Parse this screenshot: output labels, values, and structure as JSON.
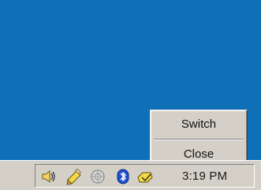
{
  "desktop": {
    "background_color": "#0f6fb7"
  },
  "context_menu": {
    "items": [
      {
        "label": "Switch"
      },
      {
        "label": "Close"
      }
    ]
  },
  "tray": {
    "icons": [
      {
        "name": "speaker-icon"
      },
      {
        "name": "pencil-icon"
      },
      {
        "name": "network-icon"
      },
      {
        "name": "bluetooth-icon"
      },
      {
        "name": "app-tray-icon"
      }
    ],
    "clock": "3:19 PM"
  }
}
